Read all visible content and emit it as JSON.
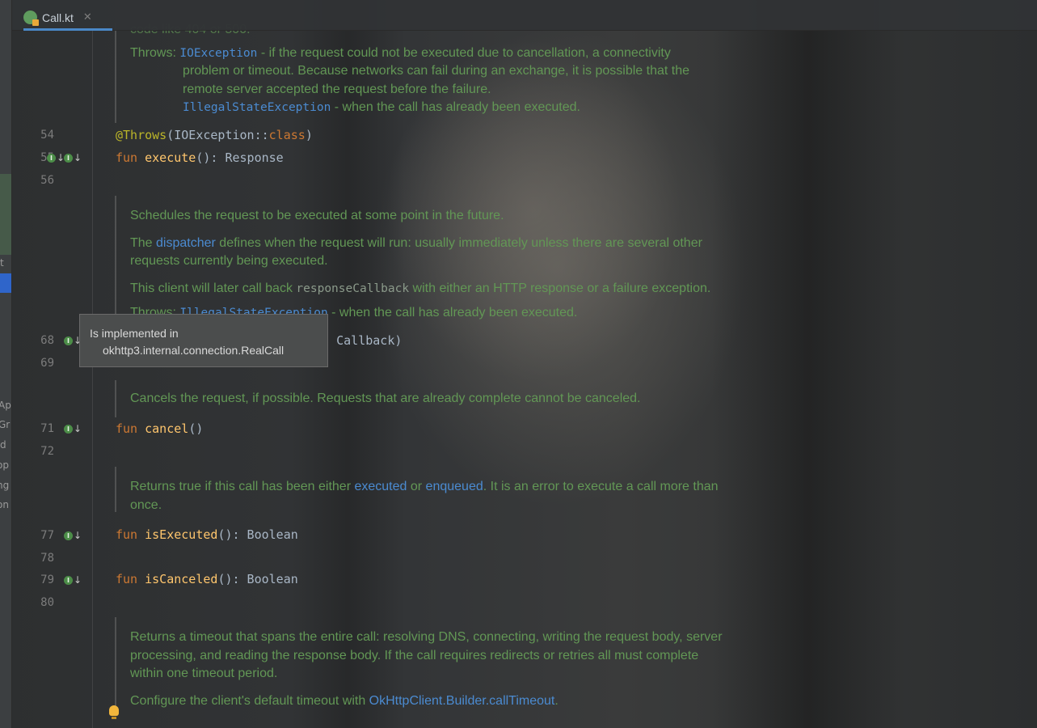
{
  "tab": {
    "file_name": "Call.kt",
    "close_glyph": "✕"
  },
  "left_panel": {
    "fragments": [
      "t",
      "Ap",
      "Gr",
      "d",
      "op",
      "ng",
      "on"
    ]
  },
  "gutter": {
    "line_numbers": {
      "l54": "54",
      "l55": "55",
      "l56": "56",
      "l68": "68",
      "l69": "69",
      "l71": "71",
      "l72": "72",
      "l77": "77",
      "l78": "78",
      "l79": "79",
      "l80": "80"
    }
  },
  "docs": {
    "execute": {
      "partial_top": "code like 404 or 500.",
      "throws_label": "Throws:",
      "io_exception": "IOException",
      "io_desc_1": " - if the request could not be executed due to cancellation, a connectivity",
      "io_desc_2": "problem or timeout. Because networks can fail during an exchange, it is possible that the",
      "io_desc_3": "remote server accepted the request before the failure.",
      "illegal_state": "IllegalStateException",
      "illegal_desc": " - when the call has already been executed."
    },
    "enqueue": {
      "p1": "Schedules the request to be executed at some point in the future.",
      "p2_pre": "The ",
      "p2_link": "dispatcher",
      "p2_post": " defines when the request will run: usually immediately unless there are several other",
      "p2_line2": "requests currently being executed.",
      "p3_pre": "This client will later call back ",
      "p3_code": "responseCallback",
      "p3_post": " with either an HTTP response or a failure exception.",
      "throws_label": "Throws:",
      "illegal_state": "IllegalStateException",
      "illegal_desc": " - when the call has already been executed."
    },
    "cancel": {
      "p1": "Cancels the request, if possible. Requests that are already complete cannot be canceled."
    },
    "is_executed": {
      "p1_pre": "Returns true if this call has been either ",
      "link1": "executed",
      "mid": " or ",
      "link2": "enqueued",
      "p1_post": ". It is an error to execute a call more than",
      "p1_line2": "once."
    },
    "timeout": {
      "p1_l1": "Returns a timeout that spans the entire call: resolving DNS, connecting, writing the request body, server",
      "p1_l2": "processing, and reading the response body. If the call requires redirects or retries all must complete",
      "p1_l3": "within one timeout period.",
      "p2_pre": "Configure the client's default timeout with ",
      "p2_link": "OkHttpClient.Builder.callTimeout",
      "p2_post": "."
    }
  },
  "code": {
    "throws_annotation": "@Throws",
    "throws_args_open": "(IOException::",
    "throws_class_kw": "class",
    "throws_args_close": ")",
    "execute_kw": "fun ",
    "execute_name": "execute",
    "execute_sig": "(): Response",
    "enqueue_visible": "ck: Callback)",
    "cancel_kw": "fun ",
    "cancel_name": "cancel",
    "cancel_sig": "()",
    "is_executed_kw": "fun ",
    "is_executed_name": "isExecuted",
    "is_executed_sig": "(): Boolean",
    "is_canceled_kw": "fun ",
    "is_canceled_name": "isCanceled",
    "is_canceled_sig": "(): Boolean"
  },
  "tooltip": {
    "title": "Is implemented in",
    "target": "okhttp3.internal.connection.RealCall"
  },
  "colors": {
    "keyword": "#cc7832",
    "function": "#ffc66d",
    "doc_text": "#629755",
    "doc_link": "#4b8bd1",
    "annotation": "#bbb529"
  }
}
